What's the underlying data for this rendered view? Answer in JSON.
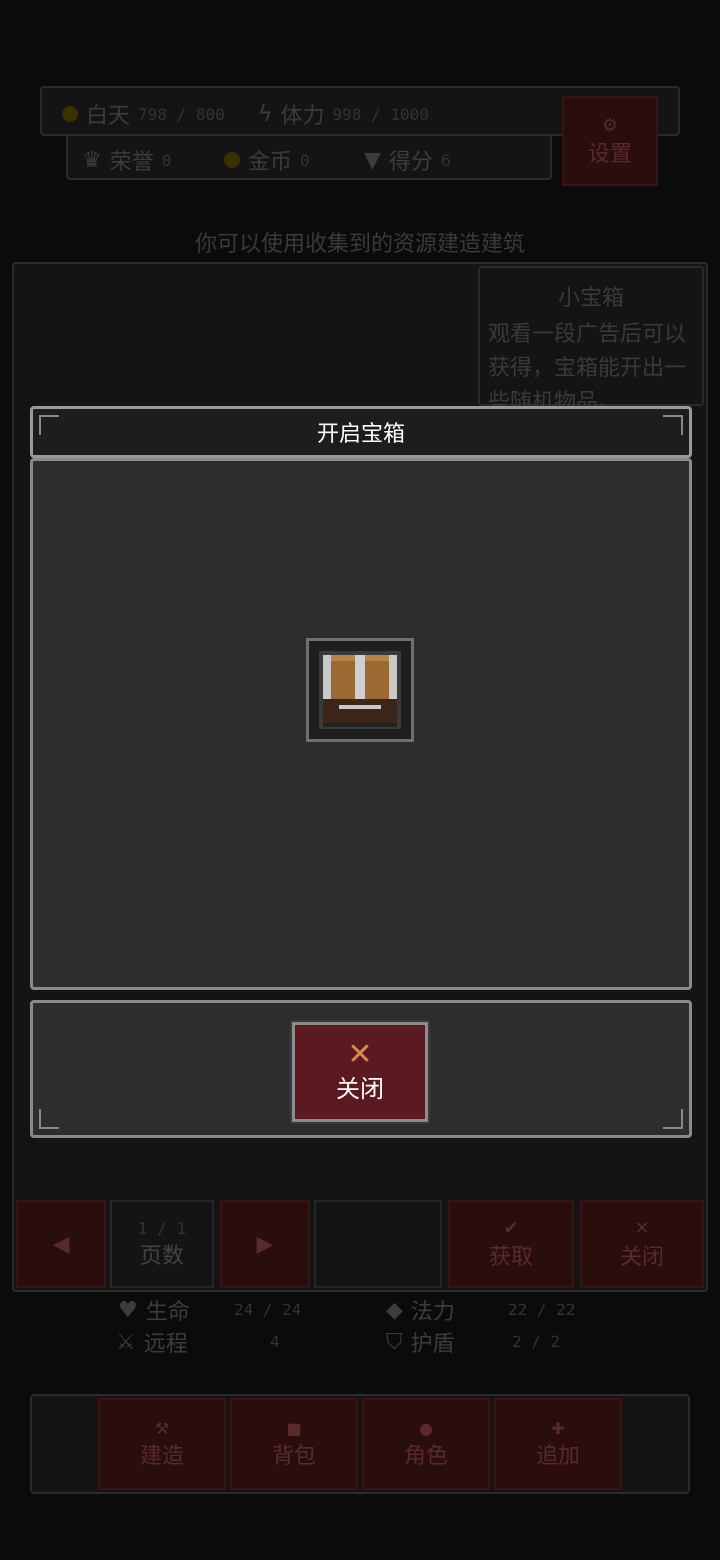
{
  "status": {
    "daytime_label": "白天",
    "daytime_value": "798 / 800",
    "stamina_label": "体力",
    "stamina_value": "998 / 1000",
    "honor_label": "荣誉",
    "honor_value": "0",
    "gold_label": "金币",
    "gold_value": "0",
    "score_label": "得分",
    "score_value": "6",
    "settings_label": "设置"
  },
  "hint_text": "你可以使用收集到的资源建造建筑",
  "item_info": {
    "title": "小宝箱",
    "description": "观看一段广告后可以获得，宝箱能开出一些随机物品。"
  },
  "pager": {
    "page_value": "1 / 1",
    "page_label": "页数",
    "prev_icon": "triangle-left-icon",
    "next_icon": "triangle-right-icon"
  },
  "actions": {
    "obtain_label": "获取",
    "close_label": "关闭"
  },
  "character_stats": {
    "life_label": "生命",
    "life_value": "24 / 24",
    "mana_label": "法力",
    "mana_value": "22 / 22",
    "ranged_label": "远程",
    "ranged_value": "4",
    "shield_label": "护盾",
    "shield_value": "2 / 2"
  },
  "bottom_nav": {
    "items": [
      {
        "label": "建造",
        "icon": "build-icon"
      },
      {
        "label": "背包",
        "icon": "bag-icon"
      },
      {
        "label": "角色",
        "icon": "character-icon"
      },
      {
        "label": "追加",
        "icon": "plus-icon"
      }
    ]
  },
  "modal": {
    "title": "开启宝箱",
    "chest_icon": "treasure-chest-icon",
    "close_label": "关闭",
    "close_icon": "close-x-icon"
  },
  "colors": {
    "modal_bg": "#2d2d2d",
    "close_button_bg": "#5a1a1f",
    "accent_orange": "#d58a4a"
  }
}
